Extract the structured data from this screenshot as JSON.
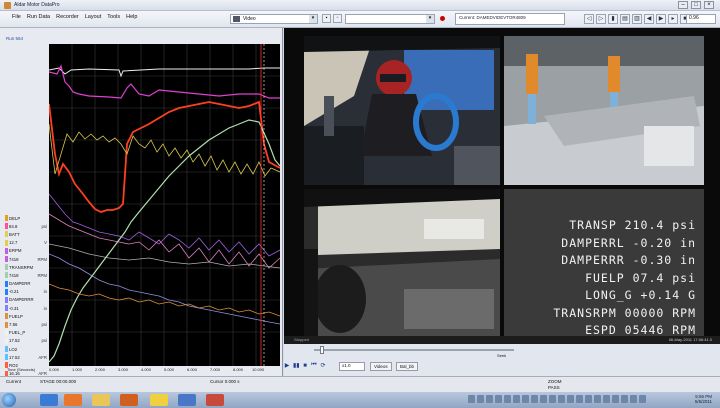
{
  "window": {
    "title": "Aldar Motor DataPro",
    "controls": [
      "–",
      "□",
      "×"
    ]
  },
  "menu": {
    "items": [
      "File",
      "Run Data",
      "Recorder",
      "Layout",
      "Tools",
      "Help"
    ]
  },
  "toolbar": {
    "video_dropdown": "Video",
    "current_label": "Current: DAMEDVIDEVTOR4809",
    "nav_buttons": [
      "◁",
      "▷",
      "▮",
      "▤",
      "▥",
      "◀",
      "▶",
      "▸",
      "■",
      "◂",
      "▹"
    ],
    "zoom_value": "0.96"
  },
  "left_panel": {
    "title": "Run 564",
    "channels": [
      {
        "name": "DELP",
        "unit": "",
        "color": "#e6a020"
      },
      {
        "name": "84.8",
        "unit": "psi",
        "color": "#ff50a0"
      },
      {
        "name": "BATT",
        "unit": "",
        "color": "#e0d050"
      },
      {
        "name": "12.7",
        "unit": "V",
        "color": "#e0d050"
      },
      {
        "name": "ERPM",
        "unit": "",
        "color": "#c060e0"
      },
      {
        "name": "7418",
        "unit": "RPM",
        "color": "#c060e0"
      },
      {
        "name": "TRANSRPM",
        "unit": "",
        "color": "#a0d0b0"
      },
      {
        "name": "7418",
        "unit": "RPM",
        "color": "#a0d0b0"
      },
      {
        "name": "DAMPERR",
        "unit": "",
        "color": "#2080ff"
      },
      {
        "name": "-0.21",
        "unit": "in",
        "color": "#2080ff"
      },
      {
        "name": "DAMPERRR",
        "unit": "",
        "color": "#8080ff"
      },
      {
        "name": "-0.31",
        "unit": "in",
        "color": "#8080ff"
      },
      {
        "name": "FUELP",
        "unit": "",
        "color": "#e09040"
      },
      {
        "name": "7.56",
        "unit": "psi",
        "color": "#e09040"
      },
      {
        "name": "FUEL_P",
        "unit": "",
        "color": "#f0f0f0"
      },
      {
        "name": "17.52",
        "unit": "psi",
        "color": "#f0f0f0"
      },
      {
        "name": "LO2",
        "unit": "",
        "color": "#60c0ff"
      },
      {
        "name": "17.52",
        "unit": "AFR",
        "color": "#60c0ff"
      },
      {
        "name": "RO2",
        "unit": "",
        "color": "#ff6040"
      },
      {
        "name": "16.16",
        "unit": "AFR",
        "color": "#ff6040"
      }
    ],
    "time_axis_label": "Time (Seconds)",
    "time_ticks": [
      "0.000",
      "1.000",
      "2.000",
      "3.000",
      "4.000",
      "5.000",
      "6.000",
      "7.000",
      "8.000",
      "9.000",
      "10.000"
    ]
  },
  "video": {
    "telemetry_overlay": [
      "TRANSP 210.4 psi",
      "DAMPERRL -0.20 in",
      "DAMPERRR -0.30 in",
      "FUELP 07.4 psi",
      "LONG_G +0.14 G",
      "TRANSRPM 00000 RPM",
      "ESPD 05446 RPM"
    ],
    "status_text": "Stopped",
    "timestamp": "06-May-2011 17:56:41.0",
    "seek_label": "Seek",
    "speed_value": "x1.0",
    "view_buttons": [
      "Videos",
      "Bal_bb"
    ]
  },
  "transport": {
    "buttons": [
      "▶",
      "▮▮",
      "■",
      "⏮",
      "⟳"
    ]
  },
  "statusbar": {
    "current_label": "Current",
    "stage": "STAGE 00:00.000",
    "cursor": "Cursor 0.000 s",
    "zoom_label": "ZOOM",
    "pass_label": "PASS"
  },
  "taskbar": {
    "clock_time": "5:56 PM",
    "clock_date": "5/6/2011"
  }
}
